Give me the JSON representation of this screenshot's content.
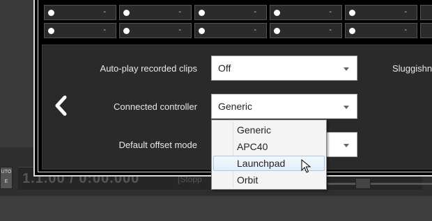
{
  "background": {
    "left_button": [
      "UTO",
      "E"
    ],
    "transport_time": "1.1.00 / 0:00.000",
    "status": "[Stopp"
  },
  "grid": {
    "rows": [
      [
        "-",
        "-",
        "-",
        "-",
        "-",
        ""
      ],
      [
        "-",
        "-",
        "-",
        "-",
        "-",
        ""
      ]
    ]
  },
  "settings": {
    "autoplay": {
      "label": "Auto-play recorded clips",
      "value": "Off"
    },
    "controller": {
      "label": "Connected controller",
      "value": "Generic"
    },
    "offset": {
      "label": "Default offset mode",
      "value": ""
    },
    "sluggishness_label": "Sluggishne"
  },
  "dropdown": {
    "options": [
      "Generic",
      "APC40",
      "Launchpad",
      "Orbit"
    ],
    "highlighted": "Launchpad"
  },
  "icons": {
    "back": "chevron-left-icon",
    "caret": "chevron-down-icon",
    "cursor": "mouse-pointer-icon"
  }
}
